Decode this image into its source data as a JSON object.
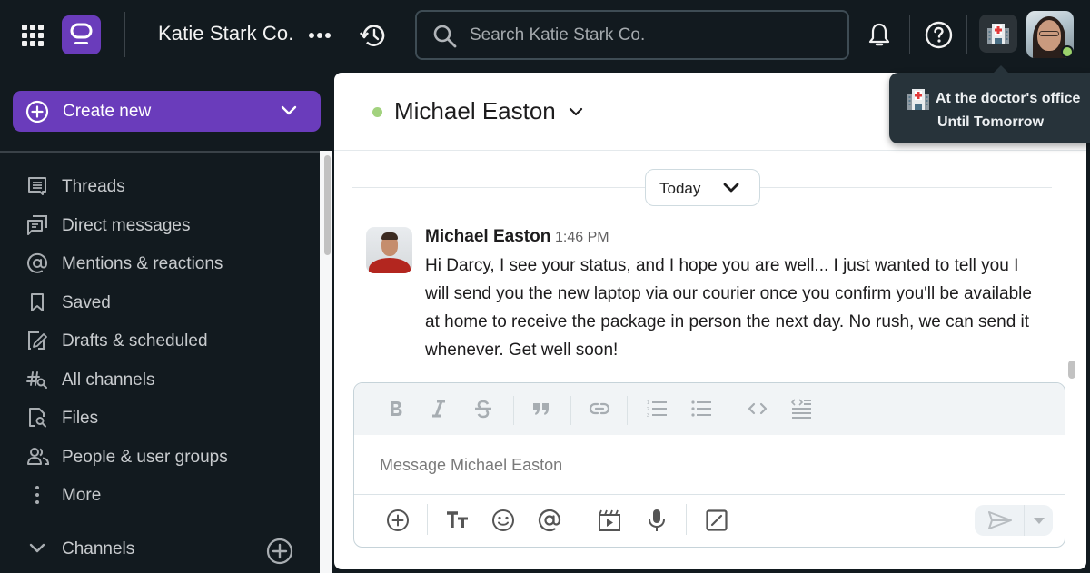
{
  "topbar": {
    "workspace_name": "Katie Stark Co.",
    "search_placeholder": "Search Katie Stark Co.",
    "status_emoji": "hospital",
    "user_presence": "online"
  },
  "status_tooltip": {
    "status_text": "At the doctor's office",
    "until_text": "Until Tomorrow"
  },
  "sidebar": {
    "create_new_label": "Create new",
    "items": [
      {
        "label": "Threads",
        "icon": "threads-icon"
      },
      {
        "label": "Direct messages",
        "icon": "direct-messages-icon"
      },
      {
        "label": "Mentions & reactions",
        "icon": "at-sign-icon"
      },
      {
        "label": "Saved",
        "icon": "bookmark-icon"
      },
      {
        "label": "Drafts & scheduled",
        "icon": "draft-pencil-icon"
      },
      {
        "label": "All channels",
        "icon": "channel-search-icon"
      },
      {
        "label": "Files",
        "icon": "file-search-icon"
      },
      {
        "label": "People & user groups",
        "icon": "people-icon"
      },
      {
        "label": "More",
        "icon": "more-vertical-icon"
      }
    ],
    "channels_label": "Channels"
  },
  "conversation": {
    "title": "Michael Easton",
    "presence": "online",
    "date_divider_label": "Today",
    "messages": [
      {
        "author": "Michael Easton",
        "time": "1:46 PM",
        "text": "Hi Darcy, I see your status, and I hope you are well... I just wanted to tell you I will send you the new laptop via our courier once you confirm you'll be available at home to receive the package in person the next day. No rush, we can send it whenever. Get well soon!"
      }
    ]
  },
  "composer": {
    "placeholder": "Message Michael Easton",
    "value": "",
    "format_tools": [
      "bold",
      "italic",
      "strikethrough",
      "blockquote",
      "link",
      "ordered-list",
      "bulleted-list",
      "code",
      "code-block"
    ],
    "actions": [
      "attach",
      "formatting",
      "emoji",
      "mention",
      "video-clip",
      "audio-clip",
      "shortcuts"
    ]
  },
  "colors": {
    "brand_purple": "#6a3cbb",
    "presence_green": "#9bd26b",
    "topbar_bg": "#121a1f",
    "tooltip_bg": "#27333a"
  }
}
